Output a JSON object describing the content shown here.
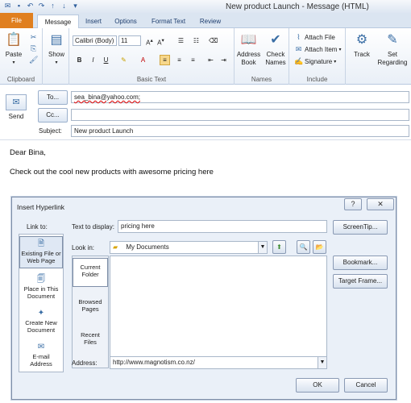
{
  "window": {
    "title": "New product Launch - Message (HTML)"
  },
  "tabs": [
    "File",
    "Message",
    "Insert",
    "Options",
    "Format Text",
    "Review"
  ],
  "ribbon": {
    "clipboard": {
      "label": "Clipboard",
      "paste": "Paste"
    },
    "show": {
      "label": "Show"
    },
    "basic_text": {
      "label": "Basic Text",
      "font": "Calibri (Body)",
      "size": "11"
    },
    "names": {
      "label": "Names",
      "address_book": [
        "Address",
        "Book"
      ],
      "check_names": [
        "Check",
        "Names"
      ]
    },
    "include": {
      "label": "Include",
      "attach_file": "Attach File",
      "attach_item": "Attach Item",
      "signature": "Signature"
    },
    "track": "Track",
    "set_regarding": [
      "Set",
      "Regarding"
    ]
  },
  "header": {
    "send": "Send",
    "to_label": "To...",
    "cc_label": "Cc...",
    "subject_label": "Subject:",
    "to_value": "sea_bina@yahoo.com;",
    "subject_value": "New product Launch"
  },
  "body": {
    "greeting": "Dear Bina,",
    "line": "Check out the cool new products with awesome pricing here"
  },
  "dialog": {
    "title": "Insert Hyperlink",
    "link_to": "Link to:",
    "text_to_display_label": "Text to display:",
    "text_to_display_value": "pricing here",
    "screentip": "ScreenTip...",
    "look_in_label": "Look in:",
    "look_in_value": "My Documents",
    "bookmark": "Bookmark...",
    "target_frame": "Target Frame...",
    "address_label": "Address:",
    "address_value": "http://www.magnotism.co.nz/",
    "ok": "OK",
    "cancel": "Cancel",
    "link_items": [
      [
        "Existing File or",
        "Web Page"
      ],
      [
        "Place in This",
        "Document"
      ],
      [
        "Create New",
        "Document"
      ],
      [
        "E-mail",
        "Address"
      ]
    ],
    "folder_items": [
      [
        "Current",
        "Folder"
      ],
      [
        "Browsed",
        "Pages"
      ],
      [
        "Recent",
        "Files"
      ]
    ]
  }
}
